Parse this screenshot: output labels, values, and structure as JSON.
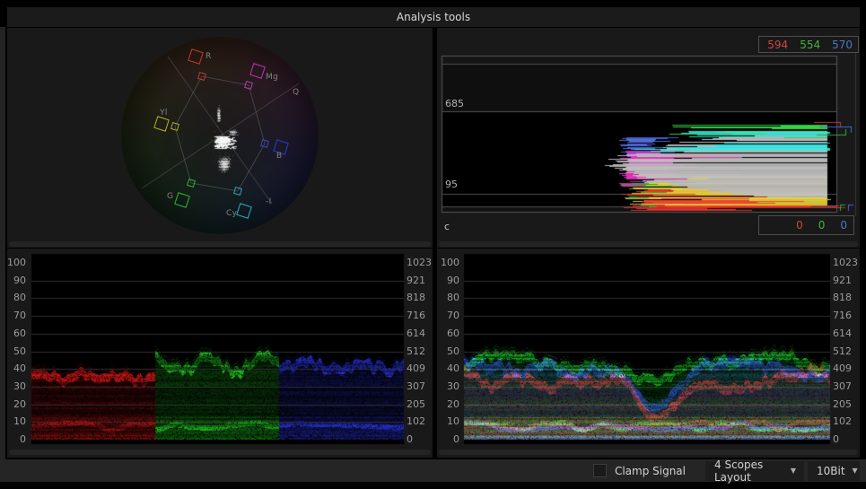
{
  "title": "Analysis tools",
  "vectorscope": {
    "targets": [
      {
        "id": "R",
        "label": "R"
      },
      {
        "id": "Mg",
        "label": "Mg"
      },
      {
        "id": "B",
        "label": "B"
      },
      {
        "id": "Cy",
        "label": "Cy"
      },
      {
        "id": "G",
        "label": "G"
      },
      {
        "id": "Yl",
        "label": "Yl"
      }
    ],
    "axis_labels": [
      {
        "id": "Q",
        "label": "Q"
      },
      {
        "id": "negI",
        "label": "-I"
      }
    ]
  },
  "histogram": {
    "max_values": {
      "r": "594",
      "g": "554",
      "b": "570"
    },
    "min_values": {
      "r": "0",
      "g": "0",
      "b": "0"
    },
    "upper_bound": "685",
    "lower_bound": "95",
    "channel_label": "c"
  },
  "waveform_axes": {
    "percent": [
      "100",
      "90",
      "80",
      "70",
      "60",
      "50",
      "40",
      "30",
      "20",
      "10",
      "0"
    ],
    "code_values": [
      "1023",
      "921",
      "818",
      "716",
      "614",
      "512",
      "409",
      "307",
      "205",
      "102",
      "0"
    ]
  },
  "controls": {
    "clamp_signal": {
      "label": "Clamp Signal",
      "checked": false
    },
    "layout_dropdown": {
      "value": "4 Scopes Layout"
    },
    "bit_depth_dropdown": {
      "value": "10Bit"
    }
  },
  "icons": {
    "chevron_down": "▼"
  },
  "colors": {
    "value_red": "#cc4545",
    "value_green": "#3fb43f",
    "value_blue": "#4878d0",
    "panel_bg": "#191919",
    "bar_bg": "#252525",
    "accent_grid": "#4c4c4c"
  }
}
